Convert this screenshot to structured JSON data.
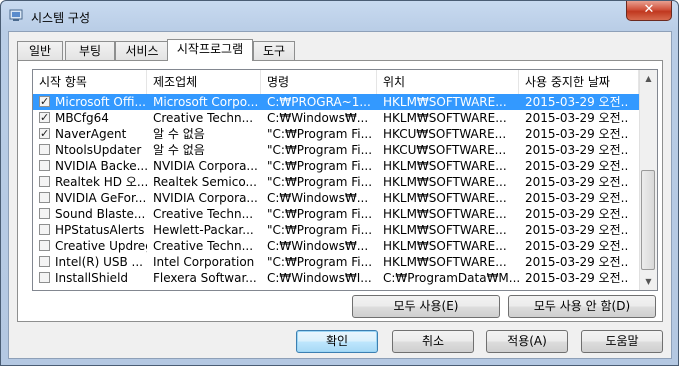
{
  "window": {
    "title": "시스템 구성",
    "close_symbol": "✕"
  },
  "tabs": [
    {
      "label": "일반",
      "active": false
    },
    {
      "label": "부팅",
      "active": false
    },
    {
      "label": "서비스",
      "active": false
    },
    {
      "label": "시작프로그램",
      "active": true
    },
    {
      "label": "도구",
      "active": false
    }
  ],
  "table": {
    "columns": [
      "시작 항목",
      "제조업체",
      "명령",
      "위치",
      "사용 중지한 날짜"
    ],
    "rows": [
      {
        "checked": true,
        "selected": true,
        "cells": [
          "Microsoft Offi...",
          "Microsoft Corpo...",
          "C:₩PROGRA~1...",
          "HKLM₩SOFTWARE...",
          "2015-03-29 오전..."
        ]
      },
      {
        "checked": true,
        "selected": false,
        "cells": [
          "MBCfg64",
          "Creative Techn...",
          "C:₩Windows₩...",
          "HKLM₩SOFTWARE...",
          "2015-03-29 오전..."
        ]
      },
      {
        "checked": true,
        "selected": false,
        "cells": [
          "NaverAgent",
          "알 수 없음",
          "\"C:₩Program Fi...",
          "HKCU₩SOFTWARE...",
          "2015-03-29 오전..."
        ]
      },
      {
        "checked": false,
        "selected": false,
        "cells": [
          "NtoolsUpdater",
          "알 수 없음",
          "\"C:₩Program Fi...",
          "HKCU₩SOFTWARE...",
          "2015-03-29 오전..."
        ]
      },
      {
        "checked": false,
        "selected": false,
        "cells": [
          "NVIDIA Backe...",
          "NVIDIA Corpora...",
          "\"C:₩Program Fi...",
          "HKLM₩SOFTWARE...",
          "2015-03-29 오전..."
        ]
      },
      {
        "checked": false,
        "selected": false,
        "cells": [
          "Realtek HD 오...",
          "Realtek Semico...",
          "\"C:₩Program Fi...",
          "HKLM₩SOFTWARE...",
          "2015-03-29 오전..."
        ]
      },
      {
        "checked": false,
        "selected": false,
        "cells": [
          "NVIDIA GeFor...",
          "NVIDIA Corpora...",
          "C:₩Windows₩...",
          "HKLM₩SOFTWARE...",
          "2015-03-29 오전..."
        ]
      },
      {
        "checked": false,
        "selected": false,
        "cells": [
          "Sound Blaste...",
          "Creative Techn...",
          "\"C:₩Program Fi...",
          "HKLM₩SOFTWARE...",
          "2015-03-29 오전..."
        ]
      },
      {
        "checked": false,
        "selected": false,
        "cells": [
          "HPStatusAlerts",
          "Hewlett-Packar...",
          "\"C:₩Program Fi...",
          "HKLM₩SOFTWARE...",
          "2015-03-29 오전..."
        ]
      },
      {
        "checked": false,
        "selected": false,
        "cells": [
          "Creative Updreg",
          "Creative Techn...",
          "C:₩Windows₩...",
          "HKLM₩SOFTWARE...",
          "2015-03-29 오전..."
        ]
      },
      {
        "checked": false,
        "selected": false,
        "cells": [
          "Intel(R) USB ...",
          "Intel Corporation",
          "\"C:₩Program Fi...",
          "HKLM₩SOFTWARE...",
          "2015-03-29 오전..."
        ]
      },
      {
        "checked": false,
        "selected": false,
        "cells": [
          "InstallShield",
          "Flexera Softwar...",
          "C:₩Windows₩I...",
          "C:₩ProgramData₩M...",
          "2015-03-29 오전..."
        ]
      }
    ]
  },
  "actions": {
    "enable_all": "모두 사용(E)",
    "disable_all": "모두 사용 안 함(D)"
  },
  "footer": {
    "ok": "확인",
    "cancel": "취소",
    "apply": "적용(A)",
    "help": "도움말"
  },
  "scrollbar": {
    "up_symbol": "▲",
    "down_symbol": "▼"
  }
}
